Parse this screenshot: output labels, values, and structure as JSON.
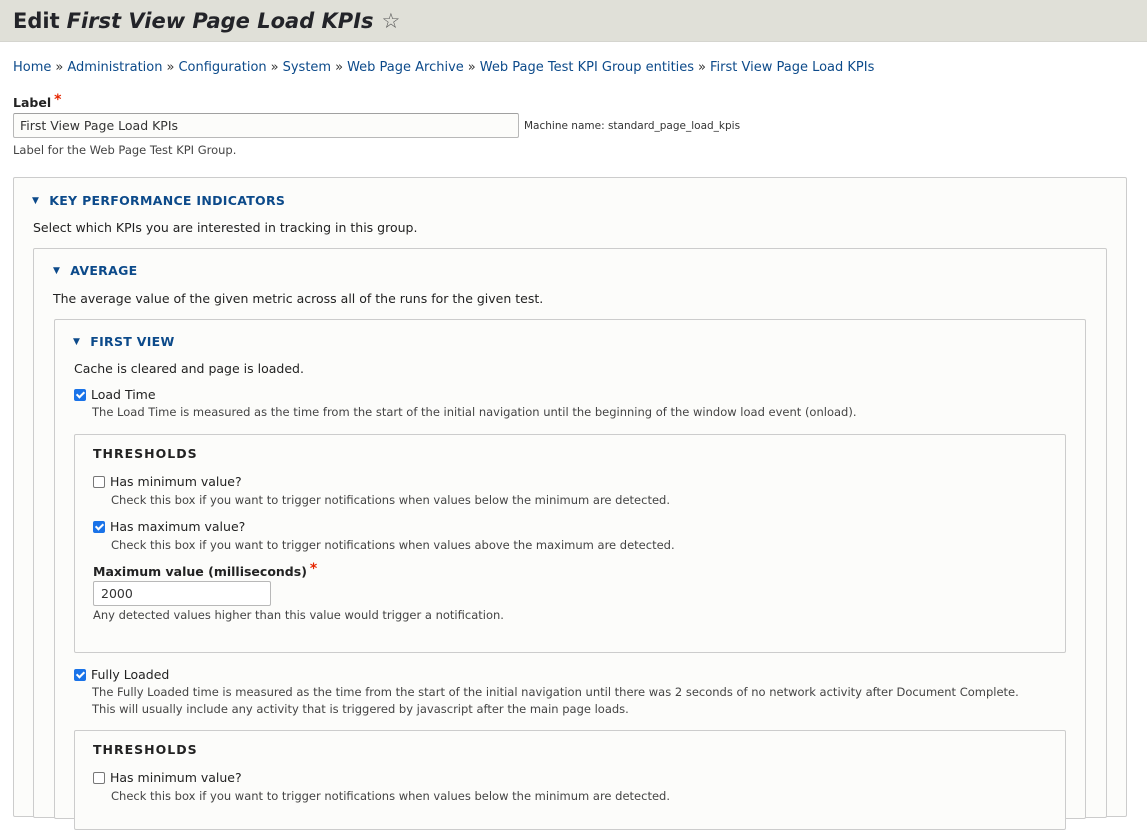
{
  "header": {
    "title_prefix": "Edit",
    "title_entity": "First View Page Load KPIs",
    "star_glyph": "☆"
  },
  "breadcrumb": {
    "items": [
      "Home",
      "Administration",
      "Configuration",
      "System",
      "Web Page Archive",
      "Web Page Test KPI Group entities",
      "First View Page Load KPIs"
    ],
    "separator": "»"
  },
  "label_field": {
    "label": "Label",
    "required_marker": "*",
    "value": "First View Page Load KPIs",
    "machine_name": "Machine name: standard_page_load_kpis",
    "description": "Label for the Web Page Test KPI Group."
  },
  "kpi_section": {
    "title": "KEY PERFORMANCE INDICATORS",
    "description": "Select which KPIs you are interested in tracking in this group."
  },
  "average_section": {
    "title": "AVERAGE",
    "description": "The average value of the given metric across all of the runs for the given test."
  },
  "first_view_section": {
    "title": "FIRST VIEW",
    "description": "Cache is cleared and page is loaded."
  },
  "load_time": {
    "label": "Load Time",
    "checked": true,
    "description": "The Load Time is measured as the time from the start of the initial navigation until the beginning of the window load event (onload).",
    "thresholds": {
      "title": "THRESHOLDS",
      "has_min_label": "Has minimum value?",
      "has_min_checked": false,
      "has_min_desc": "Check this box if you want to trigger notifications when values below the minimum are detected.",
      "has_max_label": "Has maximum value?",
      "has_max_checked": true,
      "has_max_desc": "Check this box if you want to trigger notifications when values above the maximum are detected.",
      "max_value_label": "Maximum value (milliseconds)",
      "max_value_required": "*",
      "max_value": "2000",
      "max_value_desc": "Any detected values higher than this value would trigger a notification."
    }
  },
  "fully_loaded": {
    "label": "Fully Loaded",
    "checked": true,
    "description_line1": "The Fully Loaded time is measured as the time from the start of the initial navigation until there was 2 seconds of no network activity after Document Complete.",
    "description_line2": "This will usually include any activity that is triggered by javascript after the main page loads.",
    "thresholds": {
      "title": "THRESHOLDS",
      "has_min_label": "Has minimum value?",
      "has_min_checked": false,
      "has_min_desc": "Check this box if you want to trigger notifications when values below the minimum are detected."
    }
  }
}
